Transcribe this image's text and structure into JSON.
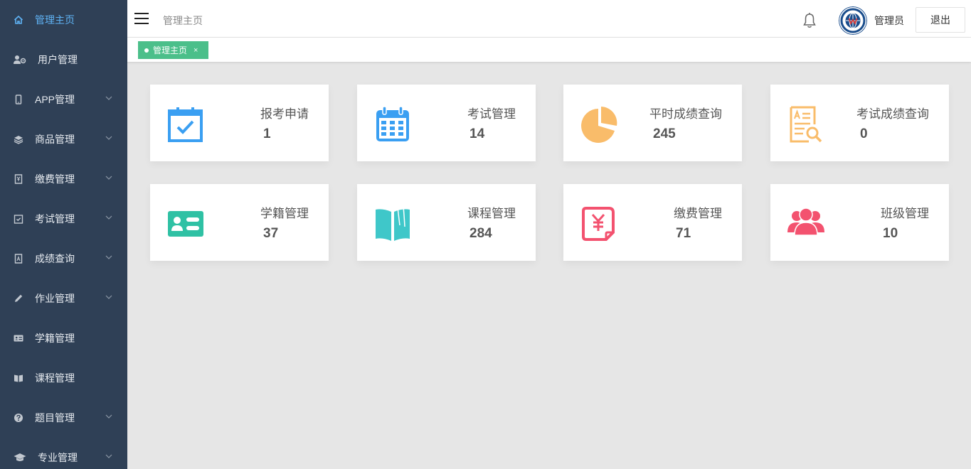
{
  "sidebar": {
    "items": [
      {
        "label": "管理主页",
        "active": true,
        "icon": "home-icon",
        "expandable": false
      },
      {
        "label": "用户管理",
        "icon": "user-settings-icon",
        "expandable": false
      },
      {
        "label": "APP管理",
        "icon": "mobile-icon",
        "expandable": true
      },
      {
        "label": "商品管理",
        "icon": "layers-icon",
        "expandable": true
      },
      {
        "label": "缴费管理",
        "icon": "payment-doc-icon",
        "expandable": true
      },
      {
        "label": "考试管理",
        "icon": "check-calendar-icon",
        "expandable": true
      },
      {
        "label": "成绩查询",
        "icon": "score-doc-icon",
        "expandable": true
      },
      {
        "label": "作业管理",
        "icon": "pencil-icon",
        "expandable": true
      },
      {
        "label": "学籍管理",
        "icon": "id-card-icon",
        "expandable": false
      },
      {
        "label": "课程管理",
        "icon": "book-icon",
        "expandable": false
      },
      {
        "label": "题目管理",
        "icon": "question-icon",
        "expandable": true
      },
      {
        "label": "专业管理",
        "icon": "graduation-cap-icon",
        "expandable": true
      }
    ]
  },
  "header": {
    "breadcrumb": "管理主页",
    "user_name": "管理员",
    "logout_label": "退出"
  },
  "tabs": [
    {
      "label": "管理主页",
      "close": "×"
    }
  ],
  "cards": [
    {
      "title": "报考申请",
      "value": "1",
      "icon": "calendar-check-icon",
      "color": "#3a9ff2"
    },
    {
      "title": "考试管理",
      "value": "14",
      "icon": "calendar-grid-icon",
      "color": "#3a9ff2"
    },
    {
      "title": "平时成绩查询",
      "value": "245",
      "icon": "pie-chart-icon",
      "color": "#f9bc6a"
    },
    {
      "title": "考试成绩查询",
      "value": "0",
      "icon": "document-search-icon",
      "color": "#f9bc6a"
    },
    {
      "title": "学籍管理",
      "value": "37",
      "icon": "id-card-icon",
      "color": "#2fc1a4"
    },
    {
      "title": "课程管理",
      "value": "284",
      "icon": "open-book-icon",
      "color": "#3fc7c9"
    },
    {
      "title": "缴费管理",
      "value": "71",
      "icon": "yuan-document-icon",
      "color": "#f3526f"
    },
    {
      "title": "班级管理",
      "value": "10",
      "icon": "users-group-icon",
      "color": "#f3526f"
    }
  ]
}
